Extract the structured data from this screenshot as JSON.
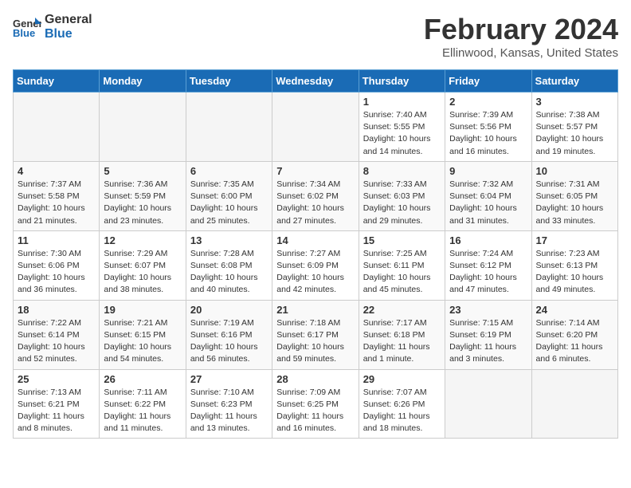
{
  "header": {
    "logo_line1": "General",
    "logo_line2": "Blue",
    "title": "February 2024",
    "subtitle": "Ellinwood, Kansas, United States"
  },
  "weekdays": [
    "Sunday",
    "Monday",
    "Tuesday",
    "Wednesday",
    "Thursday",
    "Friday",
    "Saturday"
  ],
  "weeks": [
    [
      {
        "day": "",
        "info": ""
      },
      {
        "day": "",
        "info": ""
      },
      {
        "day": "",
        "info": ""
      },
      {
        "day": "",
        "info": ""
      },
      {
        "day": "1",
        "info": "Sunrise: 7:40 AM\nSunset: 5:55 PM\nDaylight: 10 hours\nand 14 minutes."
      },
      {
        "day": "2",
        "info": "Sunrise: 7:39 AM\nSunset: 5:56 PM\nDaylight: 10 hours\nand 16 minutes."
      },
      {
        "day": "3",
        "info": "Sunrise: 7:38 AM\nSunset: 5:57 PM\nDaylight: 10 hours\nand 19 minutes."
      }
    ],
    [
      {
        "day": "4",
        "info": "Sunrise: 7:37 AM\nSunset: 5:58 PM\nDaylight: 10 hours\nand 21 minutes."
      },
      {
        "day": "5",
        "info": "Sunrise: 7:36 AM\nSunset: 5:59 PM\nDaylight: 10 hours\nand 23 minutes."
      },
      {
        "day": "6",
        "info": "Sunrise: 7:35 AM\nSunset: 6:00 PM\nDaylight: 10 hours\nand 25 minutes."
      },
      {
        "day": "7",
        "info": "Sunrise: 7:34 AM\nSunset: 6:02 PM\nDaylight: 10 hours\nand 27 minutes."
      },
      {
        "day": "8",
        "info": "Sunrise: 7:33 AM\nSunset: 6:03 PM\nDaylight: 10 hours\nand 29 minutes."
      },
      {
        "day": "9",
        "info": "Sunrise: 7:32 AM\nSunset: 6:04 PM\nDaylight: 10 hours\nand 31 minutes."
      },
      {
        "day": "10",
        "info": "Sunrise: 7:31 AM\nSunset: 6:05 PM\nDaylight: 10 hours\nand 33 minutes."
      }
    ],
    [
      {
        "day": "11",
        "info": "Sunrise: 7:30 AM\nSunset: 6:06 PM\nDaylight: 10 hours\nand 36 minutes."
      },
      {
        "day": "12",
        "info": "Sunrise: 7:29 AM\nSunset: 6:07 PM\nDaylight: 10 hours\nand 38 minutes."
      },
      {
        "day": "13",
        "info": "Sunrise: 7:28 AM\nSunset: 6:08 PM\nDaylight: 10 hours\nand 40 minutes."
      },
      {
        "day": "14",
        "info": "Sunrise: 7:27 AM\nSunset: 6:09 PM\nDaylight: 10 hours\nand 42 minutes."
      },
      {
        "day": "15",
        "info": "Sunrise: 7:25 AM\nSunset: 6:11 PM\nDaylight: 10 hours\nand 45 minutes."
      },
      {
        "day": "16",
        "info": "Sunrise: 7:24 AM\nSunset: 6:12 PM\nDaylight: 10 hours\nand 47 minutes."
      },
      {
        "day": "17",
        "info": "Sunrise: 7:23 AM\nSunset: 6:13 PM\nDaylight: 10 hours\nand 49 minutes."
      }
    ],
    [
      {
        "day": "18",
        "info": "Sunrise: 7:22 AM\nSunset: 6:14 PM\nDaylight: 10 hours\nand 52 minutes."
      },
      {
        "day": "19",
        "info": "Sunrise: 7:21 AM\nSunset: 6:15 PM\nDaylight: 10 hours\nand 54 minutes."
      },
      {
        "day": "20",
        "info": "Sunrise: 7:19 AM\nSunset: 6:16 PM\nDaylight: 10 hours\nand 56 minutes."
      },
      {
        "day": "21",
        "info": "Sunrise: 7:18 AM\nSunset: 6:17 PM\nDaylight: 10 hours\nand 59 minutes."
      },
      {
        "day": "22",
        "info": "Sunrise: 7:17 AM\nSunset: 6:18 PM\nDaylight: 11 hours\nand 1 minute."
      },
      {
        "day": "23",
        "info": "Sunrise: 7:15 AM\nSunset: 6:19 PM\nDaylight: 11 hours\nand 3 minutes."
      },
      {
        "day": "24",
        "info": "Sunrise: 7:14 AM\nSunset: 6:20 PM\nDaylight: 11 hours\nand 6 minutes."
      }
    ],
    [
      {
        "day": "25",
        "info": "Sunrise: 7:13 AM\nSunset: 6:21 PM\nDaylight: 11 hours\nand 8 minutes."
      },
      {
        "day": "26",
        "info": "Sunrise: 7:11 AM\nSunset: 6:22 PM\nDaylight: 11 hours\nand 11 minutes."
      },
      {
        "day": "27",
        "info": "Sunrise: 7:10 AM\nSunset: 6:23 PM\nDaylight: 11 hours\nand 13 minutes."
      },
      {
        "day": "28",
        "info": "Sunrise: 7:09 AM\nSunset: 6:25 PM\nDaylight: 11 hours\nand 16 minutes."
      },
      {
        "day": "29",
        "info": "Sunrise: 7:07 AM\nSunset: 6:26 PM\nDaylight: 11 hours\nand 18 minutes."
      },
      {
        "day": "",
        "info": ""
      },
      {
        "day": "",
        "info": ""
      }
    ]
  ]
}
